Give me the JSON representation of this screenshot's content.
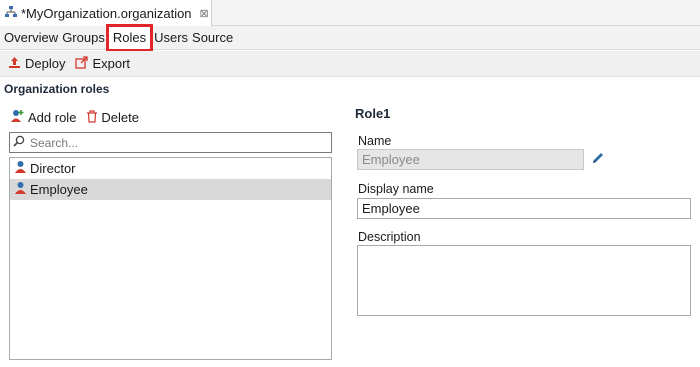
{
  "editor_tab": {
    "title": "*MyOrganization.organization",
    "close": "⊠"
  },
  "page_tabs": [
    "Overview",
    "Groups",
    "Roles",
    "Users",
    "Source"
  ],
  "toolbar": {
    "deploy": "Deploy",
    "export": "Export"
  },
  "section": {
    "title": "Organization roles"
  },
  "role_actions": {
    "add": "Add role",
    "delete": "Delete"
  },
  "search": {
    "placeholder": "Search..."
  },
  "roles": [
    {
      "name": "Director",
      "selected": false
    },
    {
      "name": "Employee",
      "selected": true
    }
  ],
  "detail": {
    "title": "Role1",
    "name_label": "Name",
    "name_value": "Employee",
    "display_label": "Display name",
    "display_value": "Employee",
    "description_label": "Description",
    "description_value": ""
  },
  "colors": {
    "highlight": "#e0262b",
    "role_icon": "#2f6ea8",
    "role_icon_accent": "#d33a2c"
  },
  "icons": [
    "org-icon",
    "close-icon",
    "deploy-icon",
    "export-icon",
    "add-role-icon",
    "delete-icon",
    "search-icon",
    "role-icon",
    "pencil-icon"
  ]
}
